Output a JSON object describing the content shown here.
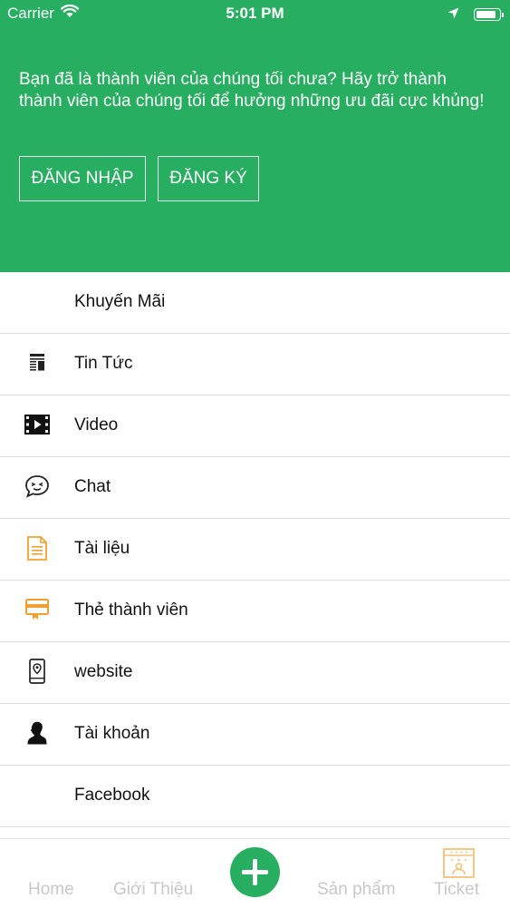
{
  "status_bar": {
    "carrier": "Carrier",
    "time": "5:01 PM",
    "battery_level": 0.92
  },
  "promo": {
    "text": "Bạn đã là thành viên của chúng tối chưa? Hãy trở thành thành viên của chúng tối để hưởng những ưu đãi cực khủng!",
    "login_label": "ĐĂNG NHẬP",
    "register_label": "ĐĂNG KÝ"
  },
  "menu": {
    "items": [
      {
        "label": "Khuyến Mãi",
        "icon": "none"
      },
      {
        "label": "Tin Tức",
        "icon": "news-icon"
      },
      {
        "label": "Video",
        "icon": "video-icon"
      },
      {
        "label": "Chat",
        "icon": "chat-icon"
      },
      {
        "label": "Tài liệu",
        "icon": "document-icon"
      },
      {
        "label": "Thẻ thành viên",
        "icon": "member-card-icon"
      },
      {
        "label": "website",
        "icon": "phone-location-icon"
      },
      {
        "label": "Tài khoản",
        "icon": "account-icon"
      },
      {
        "label": "Facebook",
        "icon": "none"
      }
    ]
  },
  "tabbar": {
    "home": "Home",
    "about": "Giới Thiệu",
    "products": "Sản phẩm",
    "ticket": "Ticket"
  },
  "colors": {
    "primary": "#27ae60",
    "tab_inactive": "#c8c8c8",
    "accent_orange": "#f0a030"
  }
}
